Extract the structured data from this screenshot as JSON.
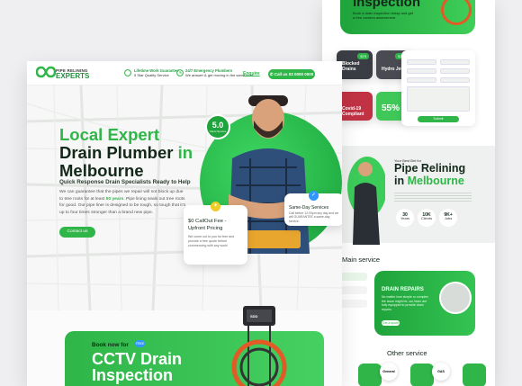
{
  "back": {
    "hero_title": "Inspection",
    "hero_sub": "Book a drain inspection today and get a free camera assessment",
    "cards": [
      {
        "label": "",
        "price": "$79"
      },
      {
        "label": "",
        "price": "$150"
      },
      {
        "label": "Covid-19 Compliant",
        "price": ""
      },
      {
        "label": "",
        "price": "55%"
      }
    ],
    "card_labels": {
      "blocked": "Blocked Drains",
      "hydro": "Hydro Jett",
      "covid": "Covid-19\nCompliant",
      "off": "55%",
      "off_sub": "OFF"
    },
    "pipe_kicker": "Your Best Bet for",
    "pipe_title_1": "Pipe Relining",
    "pipe_title_2": "in",
    "pipe_title_3": "Melbourne",
    "stats": [
      {
        "value": "30",
        "label": "Years"
      },
      {
        "value": "10K",
        "label": "Clients"
      },
      {
        "value": "9K+",
        "label": "Jobs"
      }
    ],
    "main_service": "Main service",
    "drain_repairs": "DRAIN REPAIRS",
    "drain_text": "No matter how simple or complex the issue might be, our team are fully equipped to provide drain repairs.",
    "drain_btn": "Get a quote",
    "other_service": "Other service",
    "other": [
      {
        "label": "General"
      },
      {
        "label": "GAS"
      }
    ],
    "form_submit": "Submit"
  },
  "front": {
    "logo_top": "PIPE RELINING",
    "logo_bottom": "EXPERTS",
    "nav": [
      {
        "title": "Lifetime Work Guarantee",
        "sub": "5 Star Quality Service"
      },
      {
        "title": "24/7 Emergency Plumbers",
        "sub": "We answer & get moving in the same hour"
      }
    ],
    "enquire": "Enquire",
    "call": "Call us 03 0000 0000",
    "headline_1a": "Local Expert",
    "headline_2a": "Drain Plumber",
    "headline_2b": "in",
    "headline_3": "Melbourne",
    "subheading": "Quick Response Drain Specialists Ready to Help",
    "body_pre": "We can guarantee that the pipes we repair will not block up due to tree roots for at least ",
    "body_bold": "50 years",
    "body_post": ". Pipe lining seals out tree roots for good. Our pipe liner is designed to be tough, so tough that it's up to four times stronger than a brand new pipe.",
    "contact": "Contact us",
    "rating": "5.0",
    "rating_label": "Client Service",
    "sameday_title": "Same-Day Services",
    "sameday_text": "Call before 12:00pm any day and we will GUARANTEE a same-day service.",
    "callout_title_1": "$0 CallOut Fee -",
    "callout_title_2": "Upfront Pricing",
    "callout_text": "We come out to you for free and provide a free quote before commencing with any work!",
    "banner_kicker": "Book now for",
    "banner_pill": "FREE",
    "banner_title_1": "CCTV Drain",
    "banner_title_2": "Inspection",
    "camera_label": "SDD"
  },
  "colors": {
    "accent": "#2fb548",
    "dark": "#13281a",
    "blue": "#3097ff"
  }
}
